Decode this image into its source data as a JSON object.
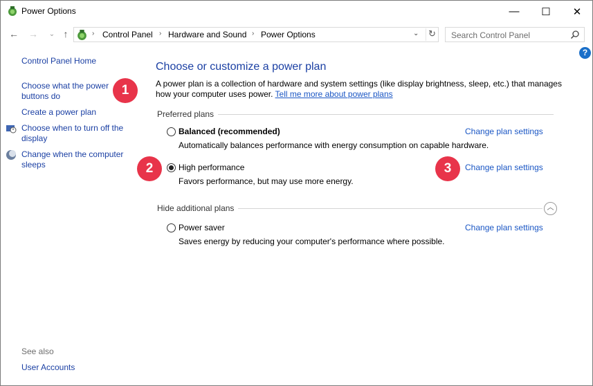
{
  "window": {
    "title": "Power Options",
    "minimize_glyph": "—",
    "maximize_glyph": "☐",
    "close_glyph": "✕"
  },
  "nav": {
    "back_glyph": "←",
    "forward_glyph": "→",
    "recent_glyph": "⌄",
    "up_glyph": "↑"
  },
  "address": {
    "separator": "›",
    "crumbs": [
      "Control Panel",
      "Hardware and Sound",
      "Power Options"
    ],
    "dropdown_glyph": "⌄",
    "refresh_glyph": "↻"
  },
  "search": {
    "placeholder": "Search Control Panel"
  },
  "help": {
    "glyph": "?"
  },
  "sidebar": {
    "home": "Control Panel Home",
    "items": [
      {
        "label": "Choose what the power buttons do"
      },
      {
        "label": "Create a power plan"
      },
      {
        "label": "Choose when to turn off the display"
      },
      {
        "label": "Change when the computer sleeps"
      }
    ],
    "see_also": "See also",
    "see_also_items": [
      "User Accounts"
    ]
  },
  "callouts": [
    "1",
    "2",
    "3"
  ],
  "main": {
    "title": "Choose or customize a power plan",
    "intro": "A power plan is a collection of hardware and system settings (like display brightness, sleep, etc.) that manages how your computer uses power. ",
    "intro_link": "Tell me more about power plans",
    "preferred_label": "Preferred plans",
    "hidden_label": "Hide additional plans",
    "collapse_glyph": "︿",
    "plans": [
      {
        "name": "Balanced (recommended)",
        "desc": "Automatically balances performance with energy consumption on capable hardware.",
        "link": "Change plan settings",
        "selected": false
      },
      {
        "name": "High performance",
        "desc": "Favors performance, but may use more energy.",
        "link": "Change plan settings",
        "selected": true
      },
      {
        "name": "Power saver",
        "desc": "Saves energy by reducing your computer's performance where possible.",
        "link": "Change plan settings",
        "selected": false
      }
    ]
  },
  "colors": {
    "link": "#1a3fa3",
    "accent_link": "#1a56c4",
    "callout": "#e8344a",
    "help": "#1a6fc9"
  }
}
